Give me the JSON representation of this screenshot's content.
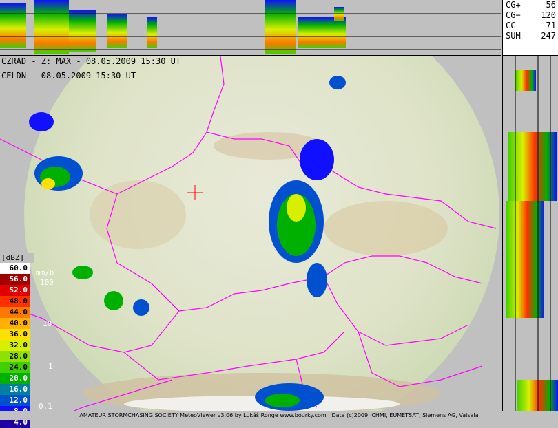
{
  "stats": [
    {
      "label": "CG+",
      "value": "56"
    },
    {
      "label": "CG−",
      "value": "120"
    },
    {
      "label": "CC",
      "value": "71"
    },
    {
      "label": "SUM",
      "value": "247"
    }
  ],
  "titles": {
    "radar": "CZRAD - Z: MAX - 08.05.2009 15:30 UT",
    "lightning": "CELDN - 08.05.2009 15:30 UT"
  },
  "legend": {
    "unit": "[dBZ]",
    "rate_unit": "mm/h",
    "levels": [
      {
        "label": "60.0",
        "color": "#ffffff"
      },
      {
        "label": "56.0",
        "color": "#a00000"
      },
      {
        "label": "52.0",
        "color": "#e00000"
      },
      {
        "label": "48.0",
        "color": "#ff3000"
      },
      {
        "label": "44.0",
        "color": "#ff7800"
      },
      {
        "label": "40.0",
        "color": "#ffb000"
      },
      {
        "label": "36.0",
        "color": "#ffe000"
      },
      {
        "label": "32.0",
        "color": "#d8f000"
      },
      {
        "label": "28.0",
        "color": "#90e000"
      },
      {
        "label": "24.0",
        "color": "#40d000"
      },
      {
        "label": "20.0",
        "color": "#00b000"
      },
      {
        "label": "16.0",
        "color": "#0080a0"
      },
      {
        "label": "12.0",
        "color": "#0050d0"
      },
      {
        "label": "8.0",
        "color": "#1010ff"
      },
      {
        "label": "4.0",
        "color": "#2000a0"
      }
    ],
    "rates": [
      "100",
      "10",
      "1",
      "0.1"
    ]
  },
  "footer": "AMATEUR STORMCHASING SOCIETY MeteoViewer v3.06 by Lukáš Ronge www.bourky.com | Data (c)2009: CHMI, EUMETSAT, Siemens AG, Vaisala",
  "colors": {
    "background": "#c0c0c0",
    "border": "#ff00ff"
  }
}
